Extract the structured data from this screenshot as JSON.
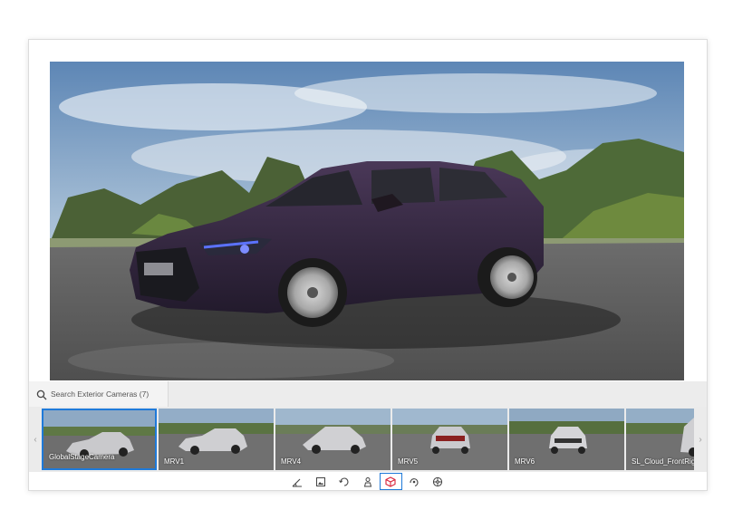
{
  "search": {
    "placeholder": "Search Exterior Cameras (7)"
  },
  "colors": {
    "accent": "#1f7ad9",
    "active_tool_icon": "#d9233a",
    "car_body": "#3a2a44"
  },
  "cameras": [
    {
      "label": "GlobalStageCamera",
      "active": true
    },
    {
      "label": "MRV1",
      "active": false
    },
    {
      "label": "MRV4",
      "active": false
    },
    {
      "label": "MRV5",
      "active": false
    },
    {
      "label": "MRV6",
      "active": false
    },
    {
      "label": "SL_Cloud_FrontRight",
      "active": false
    }
  ],
  "toolbar": {
    "icons": [
      "camera-angle-icon",
      "image-frame-icon",
      "rotate-icon",
      "person-icon",
      "cube-icon",
      "orbit-icon",
      "wheel-icon"
    ],
    "active": "cube-icon"
  }
}
